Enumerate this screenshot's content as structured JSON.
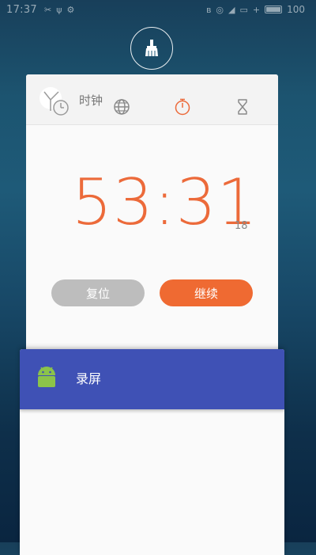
{
  "status_bar": {
    "time": "17:37",
    "battery": "100"
  },
  "clean_button": {
    "icon": "broom-icon"
  },
  "clock_card": {
    "title": "时钟",
    "tabs": [
      {
        "name": "world-clock",
        "icon": "globe-icon",
        "active": false
      },
      {
        "name": "stopwatch",
        "icon": "stopwatch-icon",
        "active": true
      },
      {
        "name": "timer",
        "icon": "hourglass-icon",
        "active": false
      }
    ],
    "time_main": "53:31",
    "time_fraction": "18",
    "reset_label": "复位",
    "continue_label": "继续"
  },
  "recorder_card": {
    "title": "录屏",
    "icon": "android-icon"
  },
  "colors": {
    "accent_orange": "#ec6a3a",
    "recorder_header": "#3f51b5",
    "reset_gray": "#bdbdbd"
  }
}
